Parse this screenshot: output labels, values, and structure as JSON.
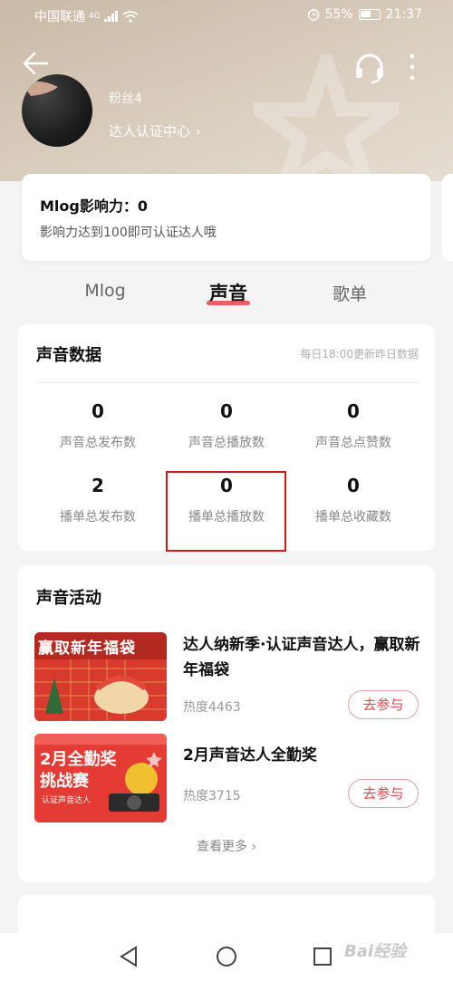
{
  "status": {
    "carrier": "中国联通",
    "network": "4G",
    "battery": "55%",
    "time": "21:37"
  },
  "header": {
    "nickname": "粉丝4",
    "cert_link": "达人认证中心",
    "icons": {
      "back": "back-arrow-icon",
      "headset": "headset-icon",
      "more": "more-vertical-icon"
    }
  },
  "mlog_card": {
    "title": "Mlog影响力：0",
    "subtitle": "影响力达到100即可认证达人哦"
  },
  "tabs": [
    {
      "label": "Mlog",
      "active": false
    },
    {
      "label": "声音",
      "active": true
    },
    {
      "label": "歌单",
      "active": false
    }
  ],
  "voice_data": {
    "title": "声音数据",
    "note": "每日18:00更新昨日数据",
    "stats": [
      {
        "value": "0",
        "label": "声音总发布数"
      },
      {
        "value": "0",
        "label": "声音总播放数"
      },
      {
        "value": "0",
        "label": "声音总点赞数"
      },
      {
        "value": "2",
        "label": "播单总发布数"
      },
      {
        "value": "0",
        "label": "播单总播放数"
      },
      {
        "value": "0",
        "label": "播单总收藏数"
      }
    ]
  },
  "activities": {
    "title": "声音活动",
    "items": [
      {
        "title": "达人纳新季·认证声音达人，赢取新年福袋",
        "heat": "热度4463",
        "button": "去参与",
        "thumb_text": "赢取新年福袋"
      },
      {
        "title": "2月声音达人全勤奖",
        "heat": "热度3715",
        "button": "去参与",
        "thumb_text": "2月全勤奖",
        "thumb_text2": "挑战赛",
        "thumb_small": "认证声音达人"
      }
    ],
    "see_more": "查看更多"
  },
  "watermark": "Bai经验",
  "colors": {
    "accent": "#e8424a",
    "highlight_box": "#d21a1a"
  }
}
